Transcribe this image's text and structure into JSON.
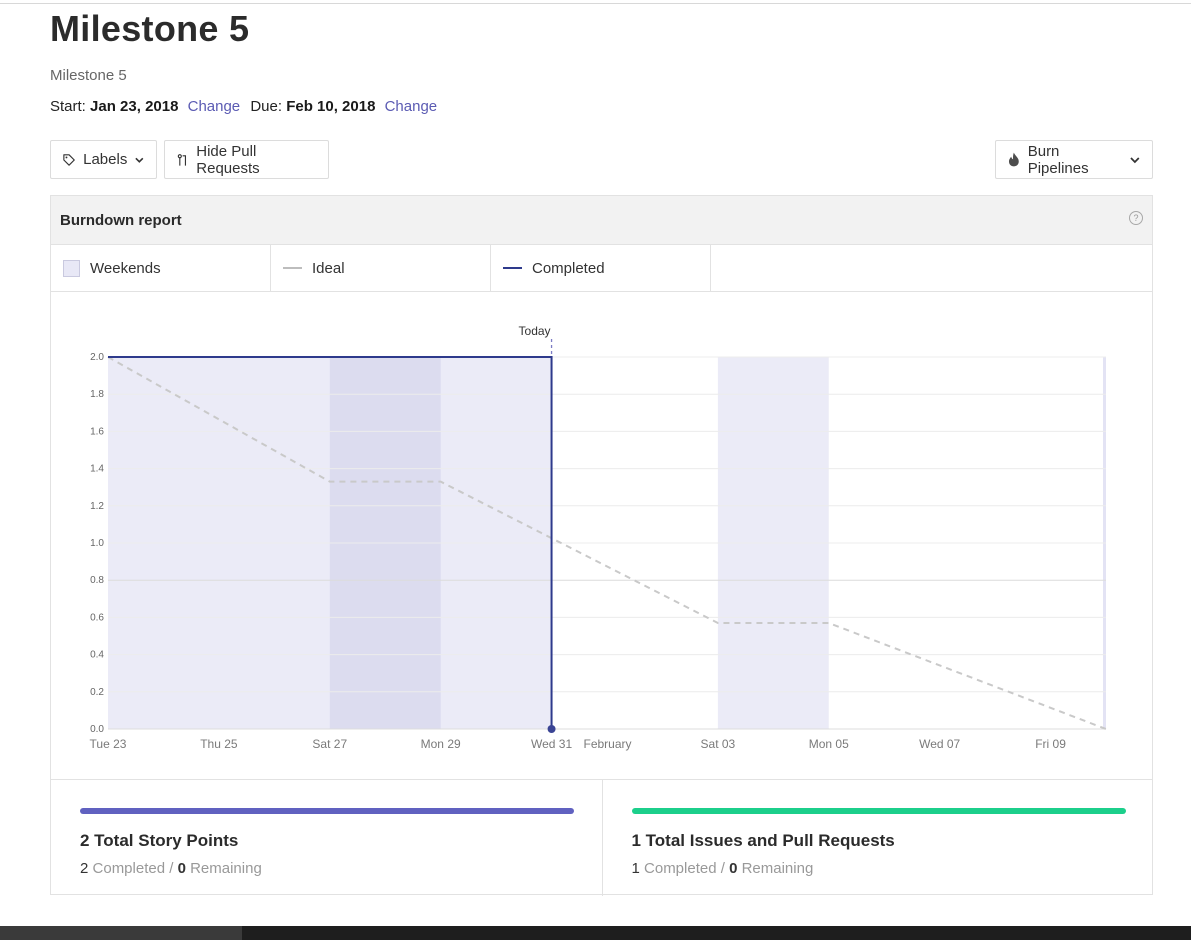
{
  "page": {
    "title": "Milestone 5",
    "subtitle": "Milestone 5",
    "start_label": "Start:",
    "start_date": "Jan 23, 2018",
    "due_label": "Due:",
    "due_date": "Feb 10, 2018",
    "change_label": "Change"
  },
  "toolbar": {
    "labels_button": "Labels",
    "hide_pr_button": "Hide Pull Requests",
    "burn_pipelines_button": "Burn Pipelines"
  },
  "report": {
    "title": "Burndown report",
    "help_icon": "?",
    "legend": [
      {
        "label": "Weekends",
        "kind": "weekend",
        "color": "#e8e8f6"
      },
      {
        "label": "Ideal",
        "kind": "line",
        "color": "#bdbdbd"
      },
      {
        "label": "Completed",
        "kind": "line",
        "color": "#2e3a8c"
      }
    ]
  },
  "chart_data": {
    "type": "line",
    "today_label": "Today",
    "today": "Wed 31",
    "x_tick_labels": [
      "Tue 23",
      "Thu 25",
      "Sat 27",
      "Mon 29",
      "Wed 31",
      "February",
      "Sat 03",
      "Mon 05",
      "Wed 07",
      "Fri 09"
    ],
    "y_tick_labels": [
      "0.0",
      "0.2",
      "0.4",
      "0.6",
      "0.8",
      "1.0",
      "1.2",
      "1.4",
      "1.6",
      "1.8",
      "2.0"
    ],
    "ylim": [
      0,
      2
    ],
    "xlim": [
      "Jan 23",
      "Feb 10"
    ],
    "weekends": [
      [
        "Jan 27",
        "Jan 29"
      ],
      [
        "Feb 03",
        "Feb 05"
      ]
    ],
    "series": [
      {
        "name": "Ideal",
        "style": "dashed",
        "color": "#c9c9c9",
        "x": [
          "Jan 23",
          "Jan 27",
          "Jan 29",
          "Feb 03",
          "Feb 05",
          "Feb 10"
        ],
        "y": [
          2.0,
          1.33,
          1.33,
          0.57,
          0.57,
          0.0
        ]
      },
      {
        "name": "Completed",
        "style": "solid",
        "color": "#2e3a8c",
        "x": [
          "Jan 23",
          "Jan 31",
          "Jan 31"
        ],
        "y": [
          2.0,
          2.0,
          0.0
        ]
      }
    ]
  },
  "stats": {
    "story": {
      "title": "2 Total Story Points",
      "completed_count": "2",
      "completed_label": "Completed /",
      "remaining_count": "0",
      "remaining_label": "Remaining",
      "color": "#6061c0",
      "progress": 1.0
    },
    "issues": {
      "title": "1 Total Issues and Pull Requests",
      "completed_count": "1",
      "completed_label": "Completed /",
      "remaining_count": "0",
      "remaining_label": "Remaining",
      "color": "#1ccf8b",
      "progress": 1.0
    }
  }
}
